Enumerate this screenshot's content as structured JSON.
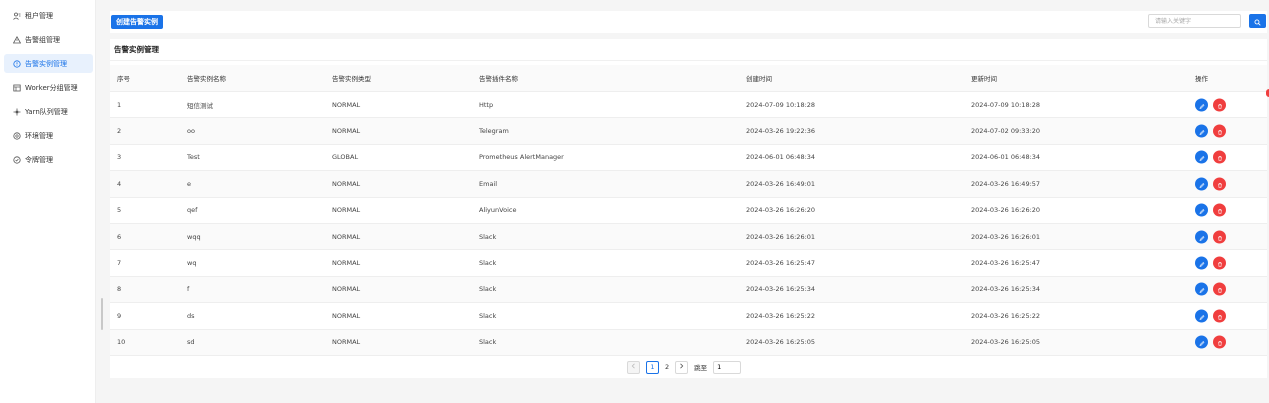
{
  "sidebar": {
    "items": [
      {
        "label": "租户管理",
        "icon": "tenant-icon",
        "active": false
      },
      {
        "label": "告警组管理",
        "icon": "alert-group-icon",
        "active": false
      },
      {
        "label": "告警实例管理",
        "icon": "alert-instance-icon",
        "active": true
      },
      {
        "label": "Worker分组管理",
        "icon": "worker-group-icon",
        "active": false
      },
      {
        "label": "Yarn队列管理",
        "icon": "yarn-queue-icon",
        "active": false
      },
      {
        "label": "环境管理",
        "icon": "environment-icon",
        "active": false
      },
      {
        "label": "令牌管理",
        "icon": "token-icon",
        "active": false
      }
    ]
  },
  "toolbar": {
    "create_label": "创建告警实例",
    "search_placeholder": "请输入关键字"
  },
  "card": {
    "title": "告警实例管理"
  },
  "table": {
    "headers": [
      "序号",
      "告警实例名称",
      "告警实例类型",
      "告警插件名称",
      "创建时间",
      "更新时间",
      "操作"
    ],
    "rows": [
      [
        "1",
        "短信测试",
        "NORMAL",
        "Http",
        "2024-07-09 10:18:28",
        "2024-07-09 10:18:28"
      ],
      [
        "2",
        "oo",
        "NORMAL",
        "Telegram",
        "2024-03-26 19:22:36",
        "2024-07-02 09:33:20"
      ],
      [
        "3",
        "Test",
        "GLOBAL",
        "Prometheus AlertManager",
        "2024-06-01 06:48:34",
        "2024-06-01 06:48:34"
      ],
      [
        "4",
        "e",
        "NORMAL",
        "Email",
        "2024-03-26 16:49:01",
        "2024-03-26 16:49:57"
      ],
      [
        "5",
        "qef",
        "NORMAL",
        "AliyunVoice",
        "2024-03-26 16:26:20",
        "2024-03-26 16:26:20"
      ],
      [
        "6",
        "wqq",
        "NORMAL",
        "Slack",
        "2024-03-26 16:26:01",
        "2024-03-26 16:26:01"
      ],
      [
        "7",
        "wq",
        "NORMAL",
        "Slack",
        "2024-03-26 16:25:47",
        "2024-03-26 16:25:47"
      ],
      [
        "8",
        "f",
        "NORMAL",
        "Slack",
        "2024-03-26 16:25:34",
        "2024-03-26 16:25:34"
      ],
      [
        "9",
        "ds",
        "NORMAL",
        "Slack",
        "2024-03-26 16:25:22",
        "2024-03-26 16:25:22"
      ],
      [
        "10",
        "sd",
        "NORMAL",
        "Slack",
        "2024-03-26 16:25:05",
        "2024-03-26 16:25:05"
      ]
    ]
  },
  "pagination": {
    "pages": [
      "1",
      "2"
    ],
    "current": "1",
    "jump_label": "跳至",
    "jump_value": "1"
  },
  "colors": {
    "primary": "#1a73e8",
    "danger": "#f03e3e"
  }
}
